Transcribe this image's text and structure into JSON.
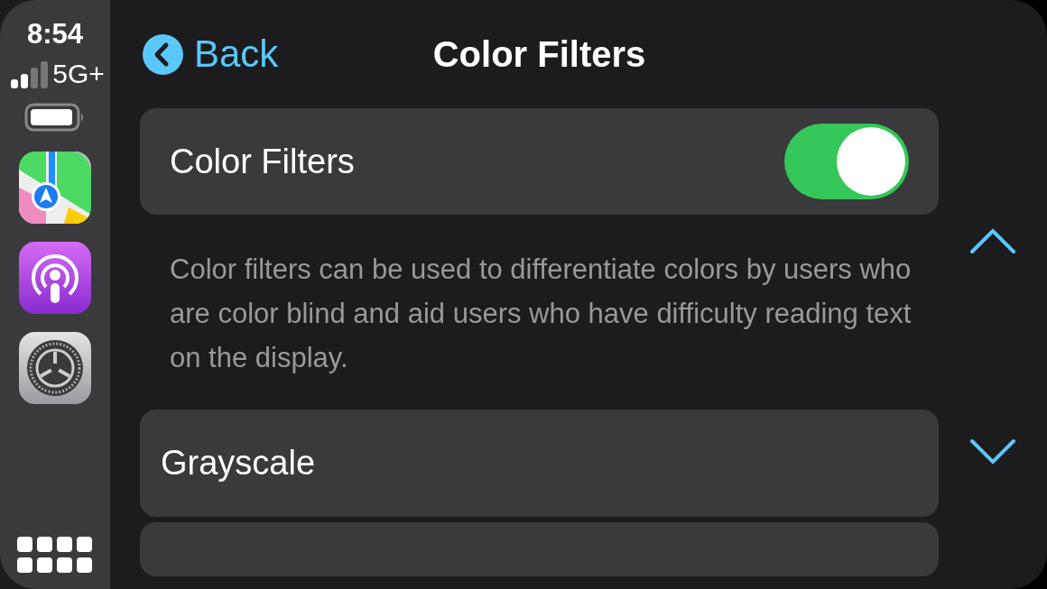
{
  "status": {
    "time": "8:54",
    "network": "5G+"
  },
  "nav": {
    "back": "Back",
    "title": "Color Filters"
  },
  "toggle_row": {
    "label": "Color Filters",
    "on": true
  },
  "description": "Color filters can be used to differentiate colors by users who are color blind and aid users who have difficulty reading text on the display.",
  "options": [
    {
      "label": "Grayscale"
    }
  ]
}
